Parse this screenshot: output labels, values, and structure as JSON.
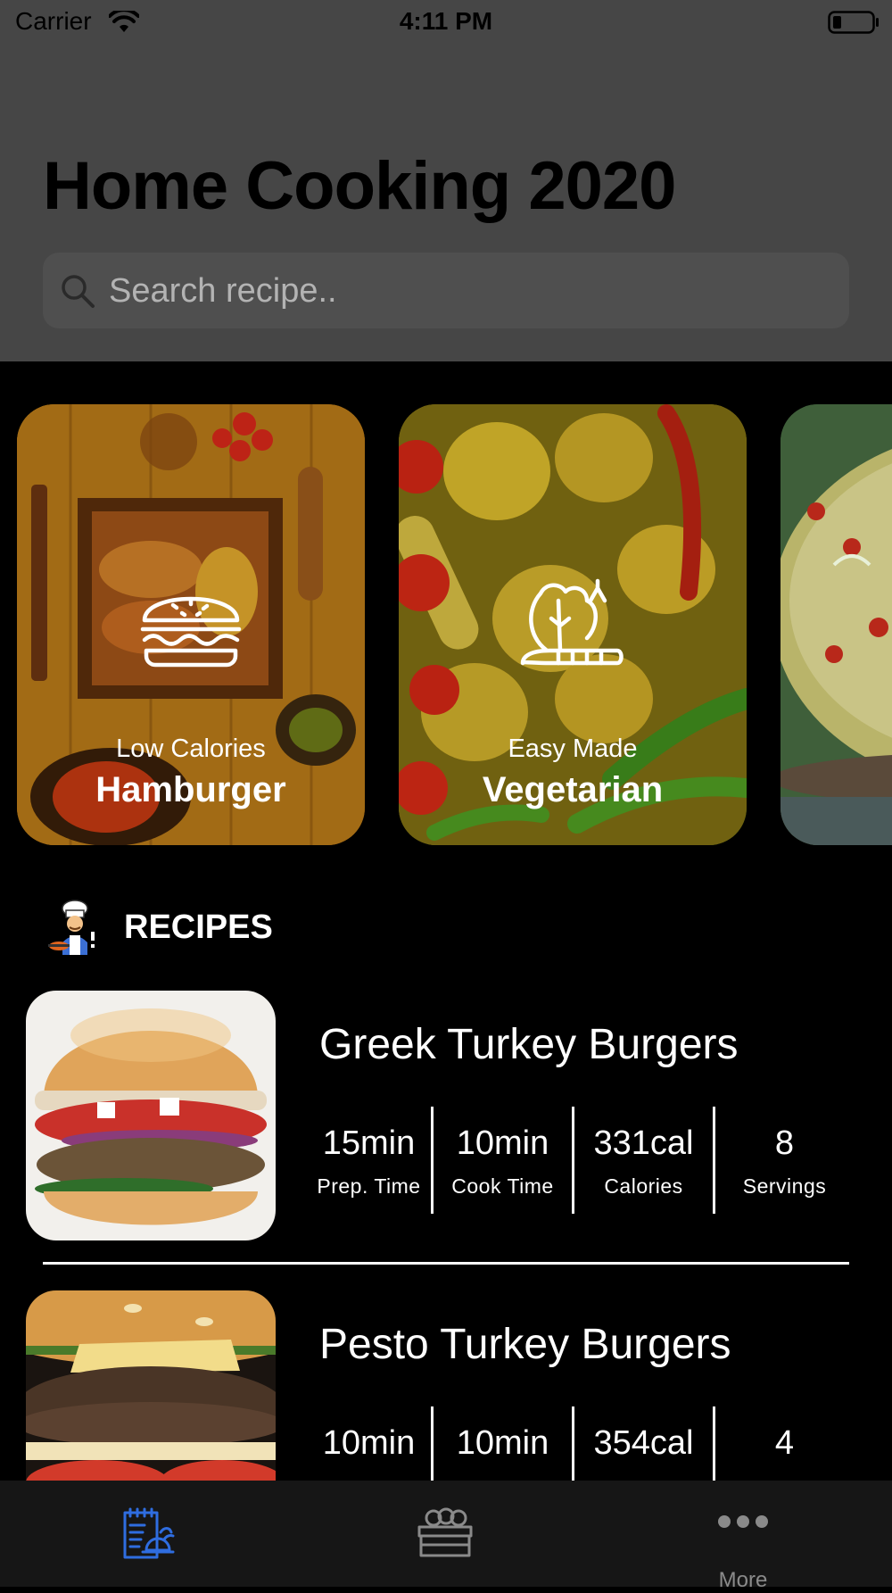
{
  "status_bar": {
    "carrier": "Carrier",
    "time": "4:11 PM"
  },
  "header": {
    "title": "Home Cooking 2020"
  },
  "search": {
    "placeholder": "Search recipe.."
  },
  "categories": [
    {
      "subtitle": "Low Calories",
      "title": "Hamburger",
      "icon": "hamburger-icon"
    },
    {
      "subtitle": "Easy Made",
      "title": "Vegetarian",
      "icon": "vegetables-icon"
    },
    {
      "subtitle": "",
      "title": "",
      "icon": ""
    }
  ],
  "section": {
    "title": "RECIPES",
    "icon": "chef-icon"
  },
  "recipes": [
    {
      "name": "Greek Turkey Burgers",
      "stats": [
        {
          "value": "15min",
          "label": "Prep. Time"
        },
        {
          "value": "10min",
          "label": "Cook Time"
        },
        {
          "value": "331cal",
          "label": "Calories"
        },
        {
          "value": "8",
          "label": "Servings"
        }
      ]
    },
    {
      "name": "Pesto Turkey Burgers",
      "stats": [
        {
          "value": "10min",
          "label": ""
        },
        {
          "value": "10min",
          "label": ""
        },
        {
          "value": "354cal",
          "label": ""
        },
        {
          "value": "4",
          "label": ""
        }
      ]
    }
  ],
  "tab_bar": {
    "tabs": [
      {
        "icon": "recipes-icon",
        "label": "",
        "active": true
      },
      {
        "icon": "groceries-crate-icon",
        "label": ""
      },
      {
        "icon": "more-dots-icon",
        "label": "More"
      }
    ],
    "active_color": "#2f6de0",
    "inactive_color": "#8a8a8a"
  }
}
